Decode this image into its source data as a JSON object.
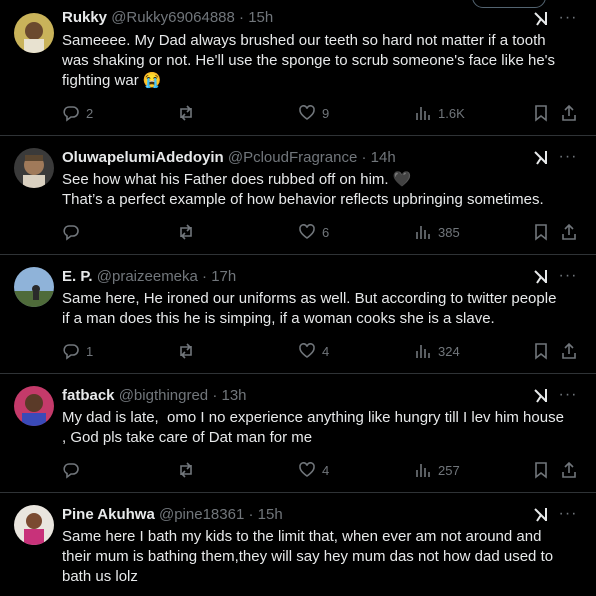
{
  "tweets": [
    {
      "name": "Rukky",
      "handle": "@Rukky69064888",
      "time": "15h",
      "text": "Sameeee. My Dad always brushed our teeth so hard not matter if a tooth\nwas shaking or not. He'll use the sponge to scrub someone's face like he's\nfighting war 😭",
      "replies": "2",
      "retweets": "",
      "likes": "9",
      "views": "1.6K"
    },
    {
      "name": "OluwapelumiAdedoyin",
      "handle": "@PcloudFragrance",
      "time": "14h",
      "text": "See how what his Father does rubbed off on him. 🖤\nThat’s a perfect example of how behavior reflects upbringing sometimes.",
      "replies": "",
      "retweets": "",
      "likes": "6",
      "views": "385"
    },
    {
      "name": "E. P.",
      "handle": "@praizeemeka",
      "time": "17h",
      "text": "Same here, He ironed our uniforms as well. But according to twitter people\nif a man does this he is simping, if a woman cooks she is a slave.",
      "replies": "1",
      "retweets": "",
      "likes": "4",
      "views": "324"
    },
    {
      "name": "fatback",
      "handle": "@bigthingred",
      "time": "13h",
      "text": "My dad is late,  omo I no experience anything like hungry till I lev him house\n, God pls take care of Dat man for me",
      "replies": "",
      "retweets": "",
      "likes": "4",
      "views": "257"
    },
    {
      "name": "Pine Akuhwa",
      "handle": "@pine18361",
      "time": "15h",
      "text": "Same here I bath my kids to the limit that, when ever am not around and\ntheir mum is bathing them,they will say hey mum das not how dad used to\nbath us lolz",
      "replies": "",
      "retweets": "",
      "likes": "",
      "views": ""
    }
  ],
  "icons": {
    "more": "more-dots-icon",
    "grok": "grok-icon",
    "reply": "reply-icon",
    "retweet": "retweet-icon",
    "like": "heart-icon",
    "views": "views-icon",
    "bookmark": "bookmark-icon",
    "share": "share-icon"
  },
  "colors": {
    "background": "#000000",
    "text": "#e7e9ea",
    "muted": "#71767b",
    "divider": "#2f3336"
  }
}
